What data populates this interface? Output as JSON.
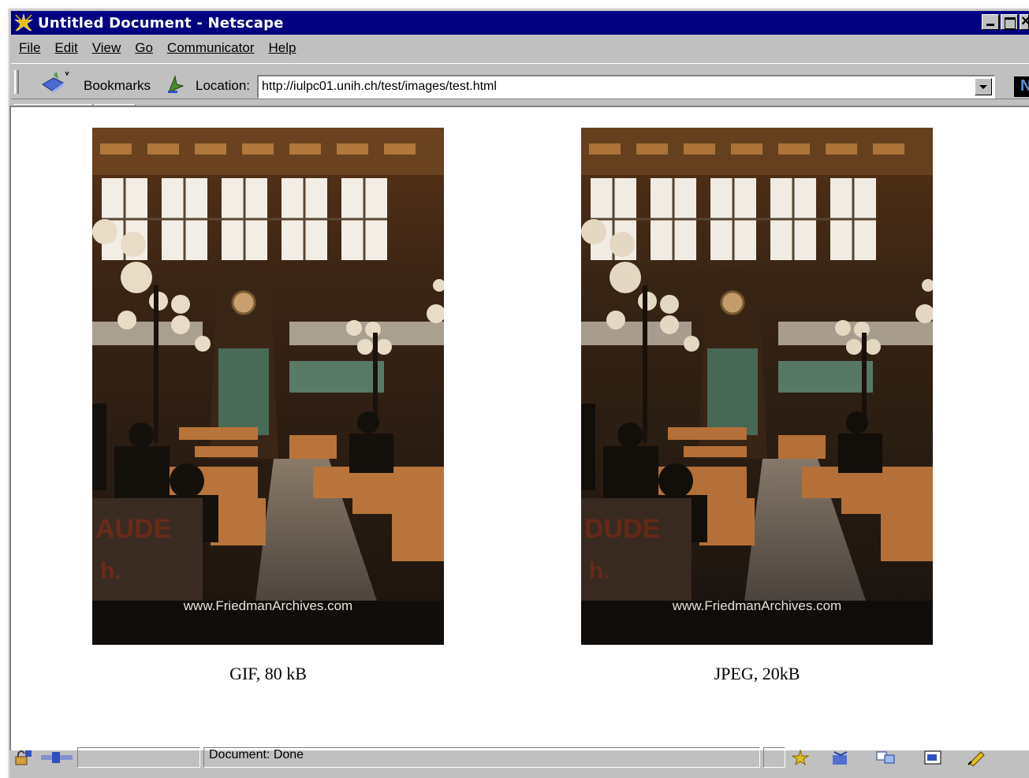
{
  "window": {
    "title": "Untitled Document - Netscape"
  },
  "menu": {
    "items": [
      "File",
      "Edit",
      "View",
      "Go",
      "Communicator",
      "Help"
    ]
  },
  "toolbar": {
    "bookmarks_label": "Bookmarks",
    "location_label": "Location:",
    "url": "http://iulpc01.unih.ch/test/images/test.html"
  },
  "content": {
    "images": [
      {
        "caption": "GIF, 80 kB",
        "watermark": "www.FriedmanArchives.com"
      },
      {
        "caption": "JPEG, 20kB",
        "watermark": "www.FriedmanArchives.com"
      }
    ]
  },
  "status": {
    "text": "Document: Done"
  },
  "colors": {
    "titlebar": "#000080",
    "chrome": "#c0c0c0",
    "page_background": "#ffffff"
  },
  "icons": {
    "app": "netscape-star-icon",
    "bookmarks": "bookmark-book-icon",
    "location": "location-pointer-icon",
    "throbber": "netscape-n-icon",
    "status": [
      "security-lock-icon",
      "connection-icon",
      "navigator-icon",
      "mail-icon",
      "discussion-icon",
      "composer-icon",
      "edit-pen-icon"
    ]
  }
}
